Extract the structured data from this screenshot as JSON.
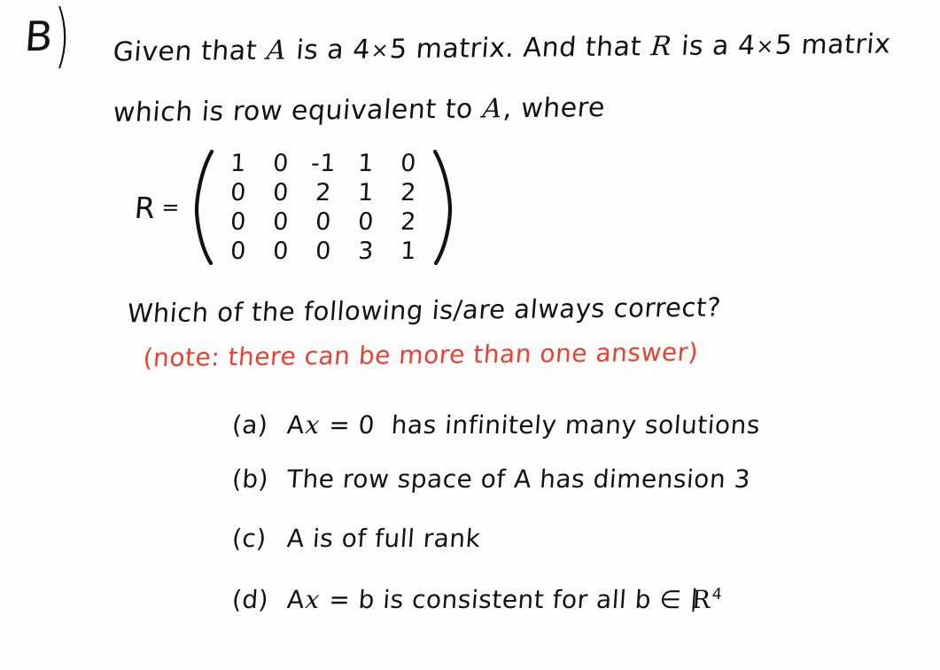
{
  "document": {
    "type": "handwritten-math-problem",
    "background_color": "#fdfdfd",
    "ink_color": "#121212",
    "accent_color": "#e8412f"
  },
  "problem": {
    "label": "B",
    "label_paren": ")",
    "prompt_line_1_part_1": "Given that",
    "prompt_line_1_var_1": "A",
    "prompt_line_1_part_2": "is a",
    "prompt_line_1_dim_1": "4",
    "prompt_line_1_times_1": "×",
    "prompt_line_1_dim_2": "5",
    "prompt_line_1_part_3": "matrix. And that",
    "prompt_line_1_var_2": "R",
    "prompt_line_1_part_4": "is a",
    "prompt_line_1_dim_3": "4",
    "prompt_line_1_times_2": "×",
    "prompt_line_1_dim_4": "5",
    "prompt_line_1_part_5": "matrix",
    "prompt_line_2_part_1": "which is row equivalent to",
    "prompt_line_2_var": "A",
    "prompt_line_2_part_2": ", where"
  },
  "matrix": {
    "name": "R",
    "equals": "=",
    "rows": [
      [
        "1",
        "0",
        "-1",
        "1",
        "0"
      ],
      [
        "0",
        "0",
        "2",
        "1",
        "2"
      ],
      [
        "0",
        "0",
        "0",
        "0",
        "2"
      ],
      [
        "0",
        "0",
        "0",
        "3",
        "1"
      ]
    ]
  },
  "question": {
    "text": "Which of the following is/are always correct?",
    "note": "(note: there can be more than one answer)"
  },
  "options": [
    {
      "label": "(a)",
      "expr": "A",
      "var": "x",
      "rest": " = 0",
      "text": "has infinitely many solutions",
      "full_text": "Ax = 0 has infinitely many solutions"
    },
    {
      "label": "(b)",
      "text": "The row space of A has dimension 3",
      "full_text": "The row space of A has dimension 3"
    },
    {
      "label": "(c)",
      "text": "A is of full rank",
      "full_text": "A is of full rank"
    },
    {
      "label": "(d)",
      "expr": "A",
      "var": "x",
      "rest": " = b",
      "text_before_set": " is consistent for all b ∈ ",
      "set_symbol": "R",
      "set_exponent": "4",
      "full_text": "Ax = b is consistent for all b ∈ R⁴"
    }
  ]
}
